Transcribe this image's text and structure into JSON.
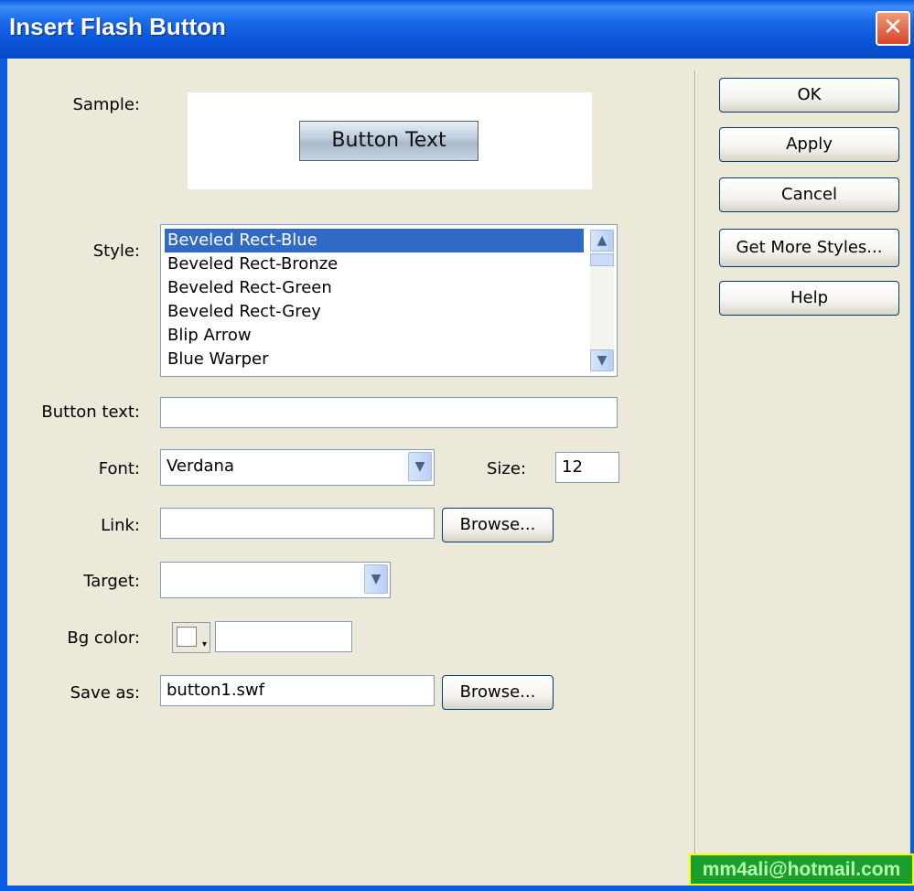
{
  "window": {
    "title": "Insert Flash Button",
    "close_glyph": "✕"
  },
  "labels": {
    "sample": "Sample:",
    "style": "Style:",
    "button_text": "Button text:",
    "font": "Font:",
    "size": "Size:",
    "link": "Link:",
    "target": "Target:",
    "bg_color": "Bg color:",
    "save_as": "Save as:"
  },
  "sample": {
    "button_text": "Button Text"
  },
  "style_list": {
    "items": [
      "Beveled Rect-Blue",
      "Beveled Rect-Bronze",
      "Beveled Rect-Green",
      "Beveled Rect-Grey",
      "Blip Arrow",
      "Blue Warper"
    ],
    "selected": "Beveled Rect-Blue",
    "scroll_up": "▲",
    "scroll_down": "▼"
  },
  "fields": {
    "button_text_value": "",
    "font_value": "Verdana",
    "size_value": "12",
    "link_value": "",
    "target_value": "",
    "bg_color_value": "",
    "save_as_value": "button1.swf",
    "dropdown_glyph": "▼",
    "swatch_glyph": "▾"
  },
  "buttons": {
    "ok": "OK",
    "apply": "Apply",
    "cancel": "Cancel",
    "get_more_styles": "Get More Styles...",
    "help": "Help",
    "browse": "Browse..."
  },
  "watermark": "mm4ali@hotmail.com",
  "colors": {
    "titlebar": "#0a5de0",
    "dialog_bg": "#ece9d8",
    "selection": "#316ac5",
    "watermark_bg": "#1b9e2e",
    "watermark_border": "#ffff00"
  }
}
